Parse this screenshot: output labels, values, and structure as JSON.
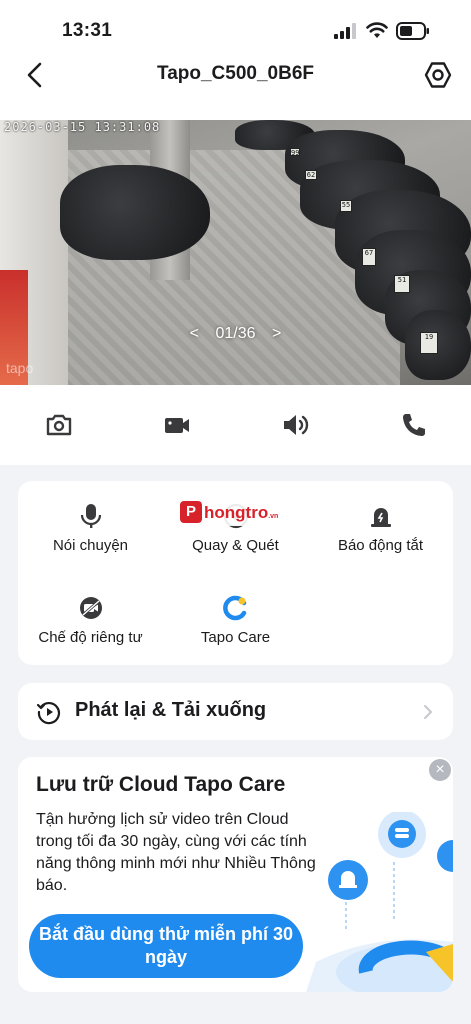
{
  "status_bar": {
    "time": "13:31"
  },
  "nav": {
    "title": "Tapo_C500_0B6F",
    "back_icon": "chevron-left-icon",
    "settings_icon": "hexagon-gear-icon"
  },
  "camera": {
    "timestamp": "2026-03-15 13:31:08",
    "pager_prev": "<",
    "pager_text": "01/36",
    "pager_next": ">",
    "watermark": "tapo",
    "plates": [
      "99",
      "62",
      "55",
      "67",
      "51",
      "19"
    ]
  },
  "controls": [
    {
      "icon": "camera-snapshot-icon"
    },
    {
      "icon": "video-record-icon"
    },
    {
      "icon": "speaker-icon"
    },
    {
      "icon": "phone-call-icon"
    }
  ],
  "features": [
    {
      "label": "Nói chuyện",
      "icon": "microphone-icon"
    },
    {
      "label": "Quay & Quét",
      "icon": "pan-tilt-icon"
    },
    {
      "label": "Báo động tắt",
      "icon": "alarm-off-icon"
    },
    {
      "label": "Chế độ riêng tư",
      "icon": "camera-off-icon"
    },
    {
      "label": "Tapo Care",
      "icon": "tapo-care-icon"
    }
  ],
  "watermark_badge": {
    "mark": "P",
    "text": "hongtro",
    "suffix": ".vn"
  },
  "playback": {
    "label": "Phát lại & Tải xuống",
    "icon": "playback-clock-icon"
  },
  "promo": {
    "title": "Lưu trữ Cloud Tapo Care",
    "body": "Tận hưởng lịch sử video trên Cloud trong tối đa 30 ngày, cùng với các tính năng thông minh mới như Nhiều Thông báo.",
    "cta": "Bắt đầu dùng thử miễn phí 30 ngày",
    "close": "×"
  },
  "colors": {
    "accent": "#1f8bef",
    "background": "#f2f3f7",
    "card": "#ffffff",
    "text": "#1c1c1e"
  }
}
